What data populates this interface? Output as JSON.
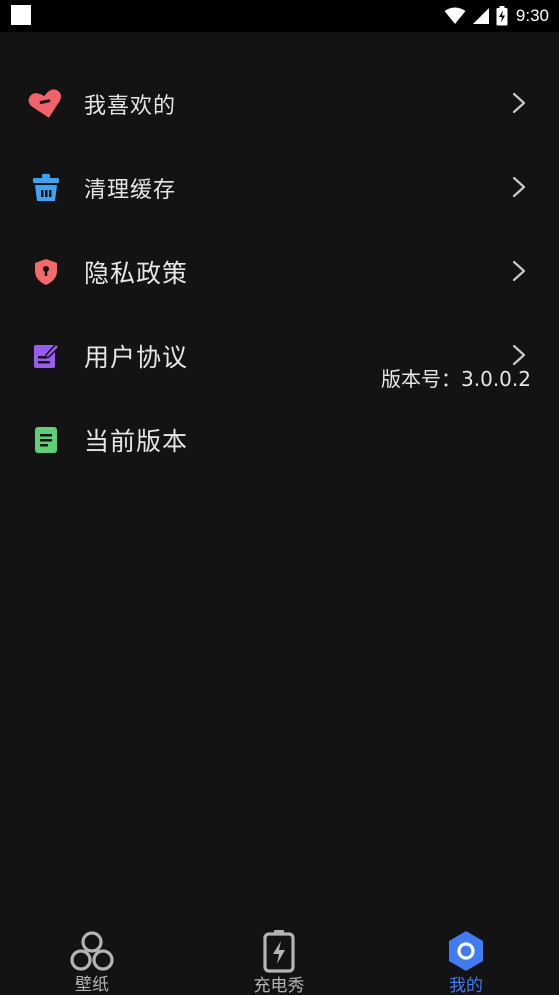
{
  "status_bar": {
    "time": "9:30",
    "icons": [
      "notification-square",
      "wifi-icon",
      "signal-icon",
      "battery-charging-icon"
    ]
  },
  "menu": {
    "items": [
      {
        "label": "我喜欢的",
        "icon": "heart-icon",
        "icon_color": "#f2626a",
        "has_chevron": true
      },
      {
        "label": "清理缓存",
        "icon": "trash-basket-icon",
        "icon_color": "#3ea3f0",
        "has_chevron": true
      },
      {
        "label": "隐私政策",
        "icon": "shield-lock-icon",
        "icon_color": "#f26a6a",
        "has_chevron": true
      },
      {
        "label": "用户协议",
        "icon": "edit-document-icon",
        "icon_color": "#9a5cf0",
        "has_chevron": true
      },
      {
        "label": "当前版本",
        "icon": "document-icon",
        "icon_color": "#5fd07a",
        "has_chevron": false
      }
    ],
    "version_value": "版本号：3.0.0.2"
  },
  "bottom_nav": {
    "items": [
      {
        "label": "壁纸",
        "icon": "clover-icon",
        "active": false
      },
      {
        "label": "充电秀",
        "icon": "battery-bolt-icon",
        "active": false
      },
      {
        "label": "我的",
        "icon": "hexagon-profile-icon",
        "active": true
      }
    ],
    "active_color": "#3f7bf2",
    "inactive_color": "#b4b4b4"
  }
}
